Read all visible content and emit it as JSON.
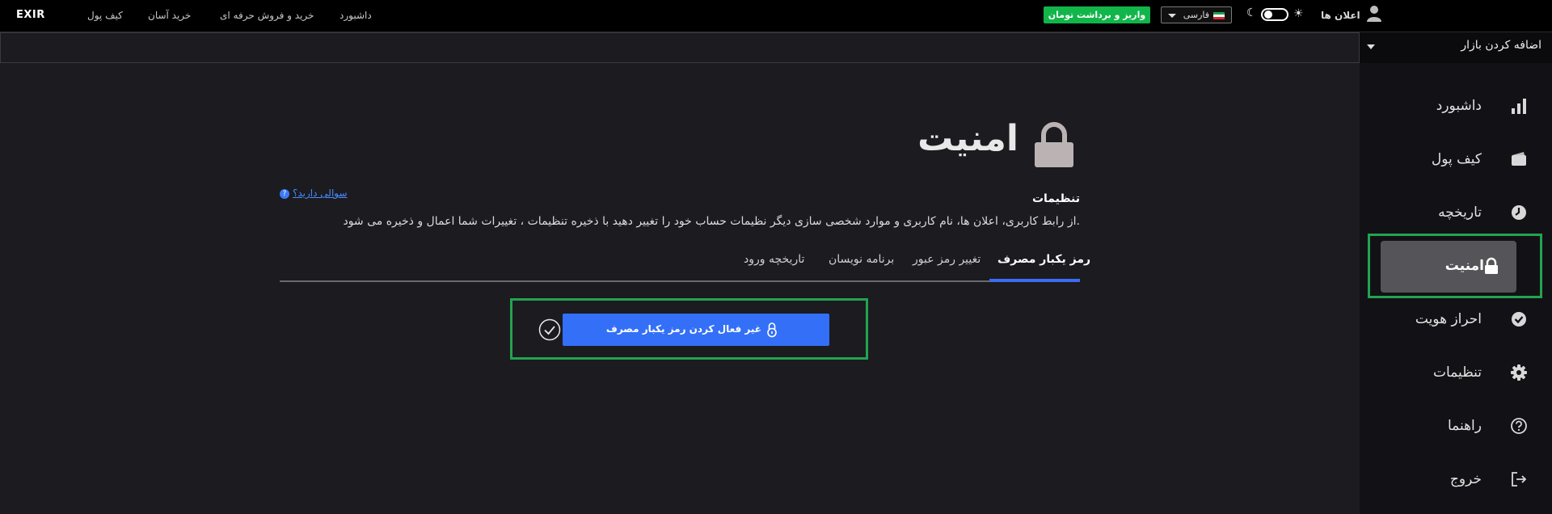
{
  "topbar": {
    "logo": "EXIR",
    "nav": [
      "کیف پول",
      "خرید آسان",
      "خرید و فروش حرفه ای",
      "داشبورد"
    ],
    "notifications": "اعلان ها",
    "language": "فارسی",
    "deposit_button": "واریز و برداشت تومان"
  },
  "sidebar": {
    "add_market": "اضافه کردن بازار",
    "items": [
      {
        "label": "داشبورد",
        "icon": "bar-chart-icon"
      },
      {
        "label": "کیف پول",
        "icon": "wallet-icon"
      },
      {
        "label": "تاریخچه",
        "icon": "clock-icon"
      },
      {
        "label": "امنیت",
        "icon": "lock-icon",
        "active": true
      },
      {
        "label": "احراز هویت",
        "icon": "verified-check-icon"
      },
      {
        "label": "تنظیمات",
        "icon": "gear-icon"
      },
      {
        "label": "راهنما",
        "icon": "help-circle-icon"
      },
      {
        "label": "خروج",
        "icon": "logout-icon"
      }
    ]
  },
  "main": {
    "title": "امنیت",
    "help_link": "سوالی دارید؟",
    "settings_heading": "تنظیمات",
    "settings_description": "از رابط کاربری، اعلان ها، نام کاربری و موارد شخصی سازی دیگر نظیمات حساب خود را تغییر دهید با ذخیره تنظیمات ، تغییرات شما اعمال و ذخیره می شود.",
    "tabs": [
      {
        "label": "رمز یکبار مصرف",
        "active": true
      },
      {
        "label": "تغییر رمز عبور"
      },
      {
        "label": "برنامه نویسان"
      },
      {
        "label": "تاریخچه ورود"
      }
    ],
    "otp_button": "غیر فعال کردن رمز یکبار مصرف"
  },
  "colors": {
    "accent_blue": "#3370f7",
    "green": "#11b54a",
    "highlight_frame": "#23a34f"
  }
}
